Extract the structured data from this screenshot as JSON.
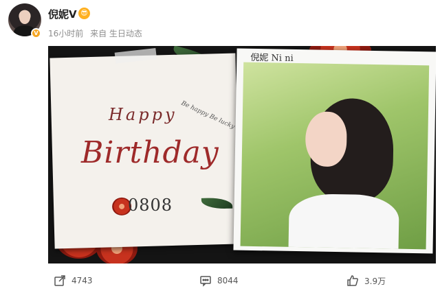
{
  "post": {
    "username": "倪妮V",
    "vip_badge": "V",
    "crown_glyph": "😎",
    "meta": {
      "time": "16小时前",
      "source": "来自 生日动态"
    }
  },
  "image": {
    "happy": "Happy",
    "be_happy": "Be happy Be lucky",
    "birthday": "Birthday",
    "date": "0808",
    "signature": "倪妮 Ni ni"
  },
  "actions": [
    {
      "icon": "share-icon",
      "count": "4743"
    },
    {
      "icon": "comment-icon",
      "count": "8044"
    },
    {
      "icon": "like-icon",
      "count": "3.9万"
    }
  ],
  "colors": {
    "accent": "#f5a623",
    "meta": "#8d8d8d",
    "card_bg": "#f4f1ec"
  }
}
